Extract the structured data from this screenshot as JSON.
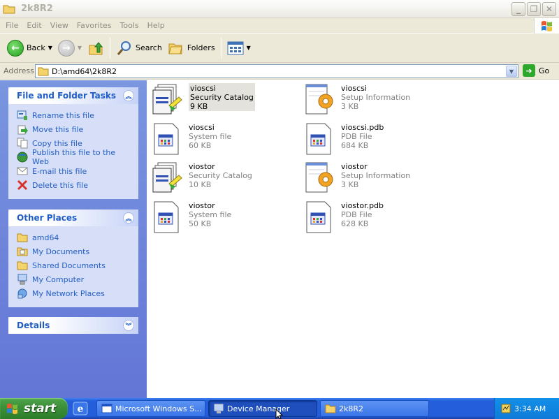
{
  "window": {
    "title": "2k8R2"
  },
  "menu": [
    "File",
    "Edit",
    "View",
    "Favorites",
    "Tools",
    "Help"
  ],
  "toolbar": {
    "back": "Back",
    "search": "Search",
    "folders": "Folders"
  },
  "address": {
    "label": "Address",
    "value": "D:\\amd64\\2k8R2",
    "go": "Go"
  },
  "tasks": {
    "title": "File and Folder Tasks",
    "items": [
      "Rename this file",
      "Move this file",
      "Copy this file",
      "Publish this file to the Web",
      "E-mail this file",
      "Delete this file"
    ]
  },
  "places": {
    "title": "Other Places",
    "items": [
      "amd64",
      "My Documents",
      "Shared Documents",
      "My Computer",
      "My Network Places"
    ]
  },
  "details": {
    "title": "Details"
  },
  "files": [
    {
      "name": "vioscsi",
      "type": "Security Catalog",
      "size": "9 KB",
      "icon": "security-catalog-icon",
      "selected": true
    },
    {
      "name": "vioscsi",
      "type": "Setup Information",
      "size": "3 KB",
      "icon": "setup-information-icon"
    },
    {
      "name": "vioscsi",
      "type": "System file",
      "size": "60 KB",
      "icon": "system-file-icon"
    },
    {
      "name": "vioscsi.pdb",
      "type": "PDB File",
      "size": "684 KB",
      "icon": "pdb-file-icon"
    },
    {
      "name": "viostor",
      "type": "Security Catalog",
      "size": "10 KB",
      "icon": "security-catalog-icon"
    },
    {
      "name": "viostor",
      "type": "Setup Information",
      "size": "3 KB",
      "icon": "setup-information-icon"
    },
    {
      "name": "viostor",
      "type": "System file",
      "size": "50 KB",
      "icon": "system-file-icon"
    },
    {
      "name": "viostor.pdb",
      "type": "PDB File",
      "size": "628 KB",
      "icon": "pdb-file-icon"
    }
  ],
  "taskbar": {
    "start": "start",
    "items": [
      "Microsoft Windows S...",
      "Device Manager",
      "2k8R2"
    ],
    "clock": "3:34 AM"
  },
  "colors": {
    "link": "#215dc6",
    "taskbar": "#245edb",
    "start": "#3b8f37"
  }
}
